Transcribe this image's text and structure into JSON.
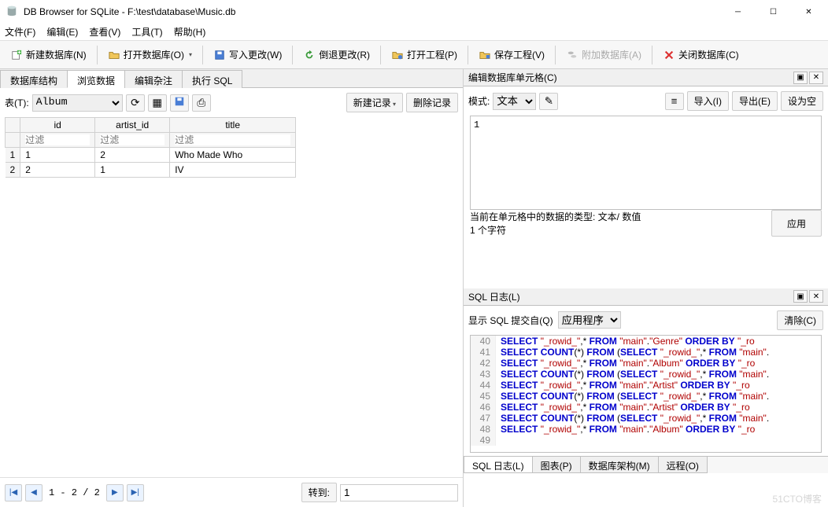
{
  "title": "DB Browser for SQLite - F:\\test\\database\\Music.db",
  "menu": {
    "file": "文件(F)",
    "edit": "编辑(E)",
    "view": "查看(V)",
    "tools": "工具(T)",
    "help": "帮助(H)"
  },
  "toolbar": {
    "new_db": "新建数据库(N)",
    "open_db": "打开数据库(O)",
    "write_changes": "写入更改(W)",
    "revert_changes": "倒退更改(R)",
    "open_project": "打开工程(P)",
    "save_project": "保存工程(V)",
    "attach_db": "附加数据库(A)",
    "close_db": "关闭数据库(C)"
  },
  "main_tabs": {
    "structure": "数据库结构",
    "browse": "浏览数据",
    "edit": "编辑杂注",
    "sql": "执行 SQL"
  },
  "browse": {
    "table_label": "表(T):",
    "table_selected": "Album",
    "new_record": "新建记录",
    "del_record": "删除记录",
    "columns": {
      "id": "id",
      "artist_id": "artist_id",
      "title": "title"
    },
    "filter_placeholder": "过滤",
    "rows": [
      {
        "rownum": "1",
        "id": "1",
        "artist_id": "2",
        "title": "Who Made Who"
      },
      {
        "rownum": "2",
        "id": "2",
        "artist_id": "1",
        "title": "IV"
      }
    ],
    "nav_status": "1 - 2 / 2",
    "goto_label": "转到:",
    "goto_value": "1"
  },
  "cell_editor": {
    "title": "编辑数据库单元格(C)",
    "mode_label": "模式:",
    "mode_value": "文本",
    "import": "导入(I)",
    "export": "导出(E)",
    "set_null": "设为空",
    "content": "1",
    "type_line": "当前在单元格中的数据的类型: 文本/ 数值",
    "size_line": "1 个字符",
    "apply": "应用"
  },
  "sql_log": {
    "title": "SQL 日志(L)",
    "show_label": "显示 SQL 提交自(Q)",
    "source": "应用程序",
    "clear": "清除(C)",
    "lines": [
      {
        "n": "40",
        "html": "<span class=\"kw\">SELECT</span> <span class=\"str\">\"_rowid_\"</span>,* <span class=\"kw\">FROM</span> <span class=\"str\">\"main\"</span>.<span class=\"str\">\"Genre\"</span> <span class=\"kw\">ORDER BY</span> <span class=\"str\">\"_ro"
      },
      {
        "n": "41",
        "html": "<span class=\"kw\">SELECT</span> <span class=\"kw\">COUNT</span>(*) <span class=\"kw\">FROM</span> (<span class=\"kw\">SELECT</span> <span class=\"str\">\"_rowid_\"</span>,* <span class=\"kw\">FROM</span> <span class=\"str\">\"main\"</span>."
      },
      {
        "n": "42",
        "html": "<span class=\"kw\">SELECT</span> <span class=\"str\">\"_rowid_\"</span>,* <span class=\"kw\">FROM</span> <span class=\"str\">\"main\"</span>.<span class=\"str\">\"Album\"</span> <span class=\"kw\">ORDER BY</span> <span class=\"str\">\"_ro"
      },
      {
        "n": "43",
        "html": "<span class=\"kw\">SELECT</span> <span class=\"kw\">COUNT</span>(*) <span class=\"kw\">FROM</span> (<span class=\"kw\">SELECT</span> <span class=\"str\">\"_rowid_\"</span>,* <span class=\"kw\">FROM</span> <span class=\"str\">\"main\"</span>."
      },
      {
        "n": "44",
        "html": "<span class=\"kw\">SELECT</span> <span class=\"str\">\"_rowid_\"</span>,* <span class=\"kw\">FROM</span> <span class=\"str\">\"main\"</span>.<span class=\"str\">\"Artist\"</span> <span class=\"kw\">ORDER BY</span> <span class=\"str\">\"_ro"
      },
      {
        "n": "45",
        "html": "<span class=\"kw\">SELECT</span> <span class=\"kw\">COUNT</span>(*) <span class=\"kw\">FROM</span> (<span class=\"kw\">SELECT</span> <span class=\"str\">\"_rowid_\"</span>,* <span class=\"kw\">FROM</span> <span class=\"str\">\"main\"</span>."
      },
      {
        "n": "46",
        "html": "<span class=\"kw\">SELECT</span> <span class=\"str\">\"_rowid_\"</span>,* <span class=\"kw\">FROM</span> <span class=\"str\">\"main\"</span>.<span class=\"str\">\"Artist\"</span> <span class=\"kw\">ORDER BY</span> <span class=\"str\">\"_ro"
      },
      {
        "n": "47",
        "html": "<span class=\"kw\">SELECT</span> <span class=\"kw\">COUNT</span>(*) <span class=\"kw\">FROM</span> (<span class=\"kw\">SELECT</span> <span class=\"str\">\"_rowid_\"</span>,* <span class=\"kw\">FROM</span> <span class=\"str\">\"main\"</span>."
      },
      {
        "n": "48",
        "html": "<span class=\"kw\">SELECT</span> <span class=\"str\">\"_rowid_\"</span>,* <span class=\"kw\">FROM</span> <span class=\"str\">\"main\"</span>.<span class=\"str\">\"Album\"</span> <span class=\"kw\">ORDER BY</span> <span class=\"str\">\"_ro"
      },
      {
        "n": "49",
        "html": ""
      }
    ]
  },
  "bottom_tabs": {
    "log": "SQL 日志(L)",
    "chart": "图表(P)",
    "schema": "数据库架构(M)",
    "remote": "远程(O)"
  },
  "watermark": "51CTO博客"
}
